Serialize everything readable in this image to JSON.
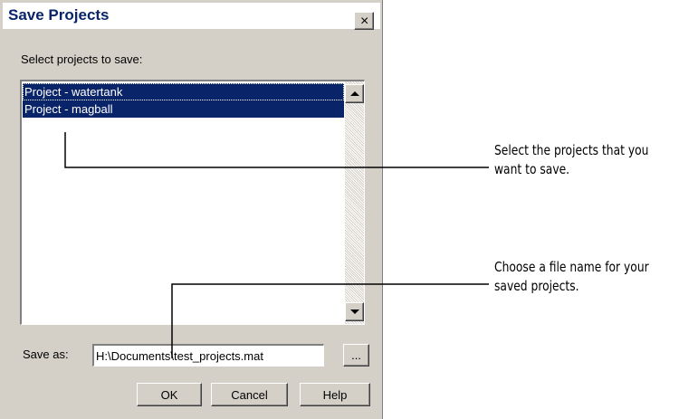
{
  "dialog": {
    "title": "Save Projects",
    "close_glyph": "×",
    "prompt": "Select projects to save:",
    "projects": [
      {
        "label": "Project - watertank",
        "selected": true,
        "focused": true
      },
      {
        "label": "Project - magball",
        "selected": true,
        "focused": false
      }
    ],
    "scroll_up_icon": "scroll-up-arrow-icon",
    "scroll_down_icon": "scroll-down-arrow-icon",
    "save_as_label": "Save as:",
    "save_as_value": "H:\\Documents\\test_projects.mat",
    "browse_label": "...",
    "ok_label": "OK",
    "cancel_label": "Cancel",
    "help_label": "Help"
  },
  "annotations": [
    {
      "lines": [
        "Select the projects that you",
        "want to save."
      ]
    },
    {
      "lines": [
        "Choose a file name for your",
        "saved projects."
      ]
    }
  ],
  "colors": {
    "dialog_face": "#d4d0c8",
    "selection": "#0a246a",
    "title_text": "#0a246a"
  }
}
